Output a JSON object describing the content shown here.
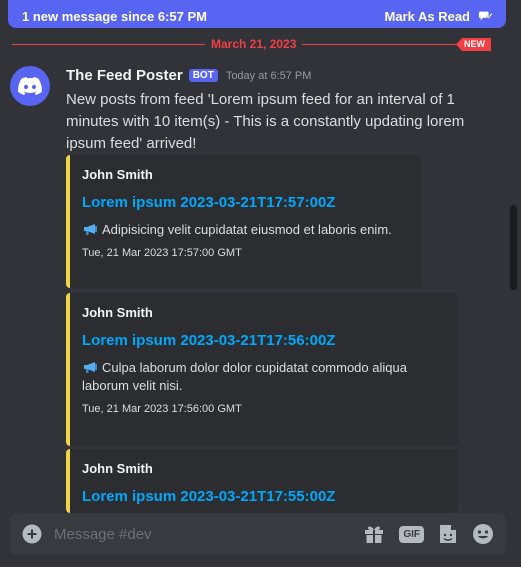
{
  "banner": {
    "text": "1 new message since 6:57 PM",
    "action": "Mark As Read"
  },
  "divider": {
    "date": "March 21, 2023",
    "tag": "NEW"
  },
  "message": {
    "author": "The Feed Poster",
    "badge": "BOT",
    "timestamp": "Today at 6:57 PM",
    "content": "New posts from feed 'Lorem ipsum feed for an interval of 1 minutes with 10 item(s) - This is a constantly updating lorem ipsum feed' arrived!",
    "embeds": [
      {
        "author": "John Smith",
        "title": "Lorem ipsum 2023-03-21T17:57:00Z",
        "description": "Adipisicing velit cupidatat eiusmod et laboris enim.",
        "footer": "Tue, 21 Mar 2023 17:57:00 GMT"
      },
      {
        "author": "John Smith",
        "title": "Lorem ipsum 2023-03-21T17:56:00Z",
        "description": "Culpa laborum dolor dolor cupidatat commodo aliqua laborum velit nisi.",
        "footer": "Tue, 21 Mar 2023 17:56:00 GMT"
      },
      {
        "author": "John Smith",
        "title": "Lorem ipsum 2023-03-21T17:55:00Z",
        "description": "",
        "footer": ""
      }
    ]
  },
  "composer": {
    "placeholder": "Message #dev",
    "gif_label": "GIF"
  },
  "colors": {
    "accent": "#5865f2",
    "new_red": "#f23f43",
    "embed_border": "#f0d54b",
    "link": "#00a8fc"
  }
}
